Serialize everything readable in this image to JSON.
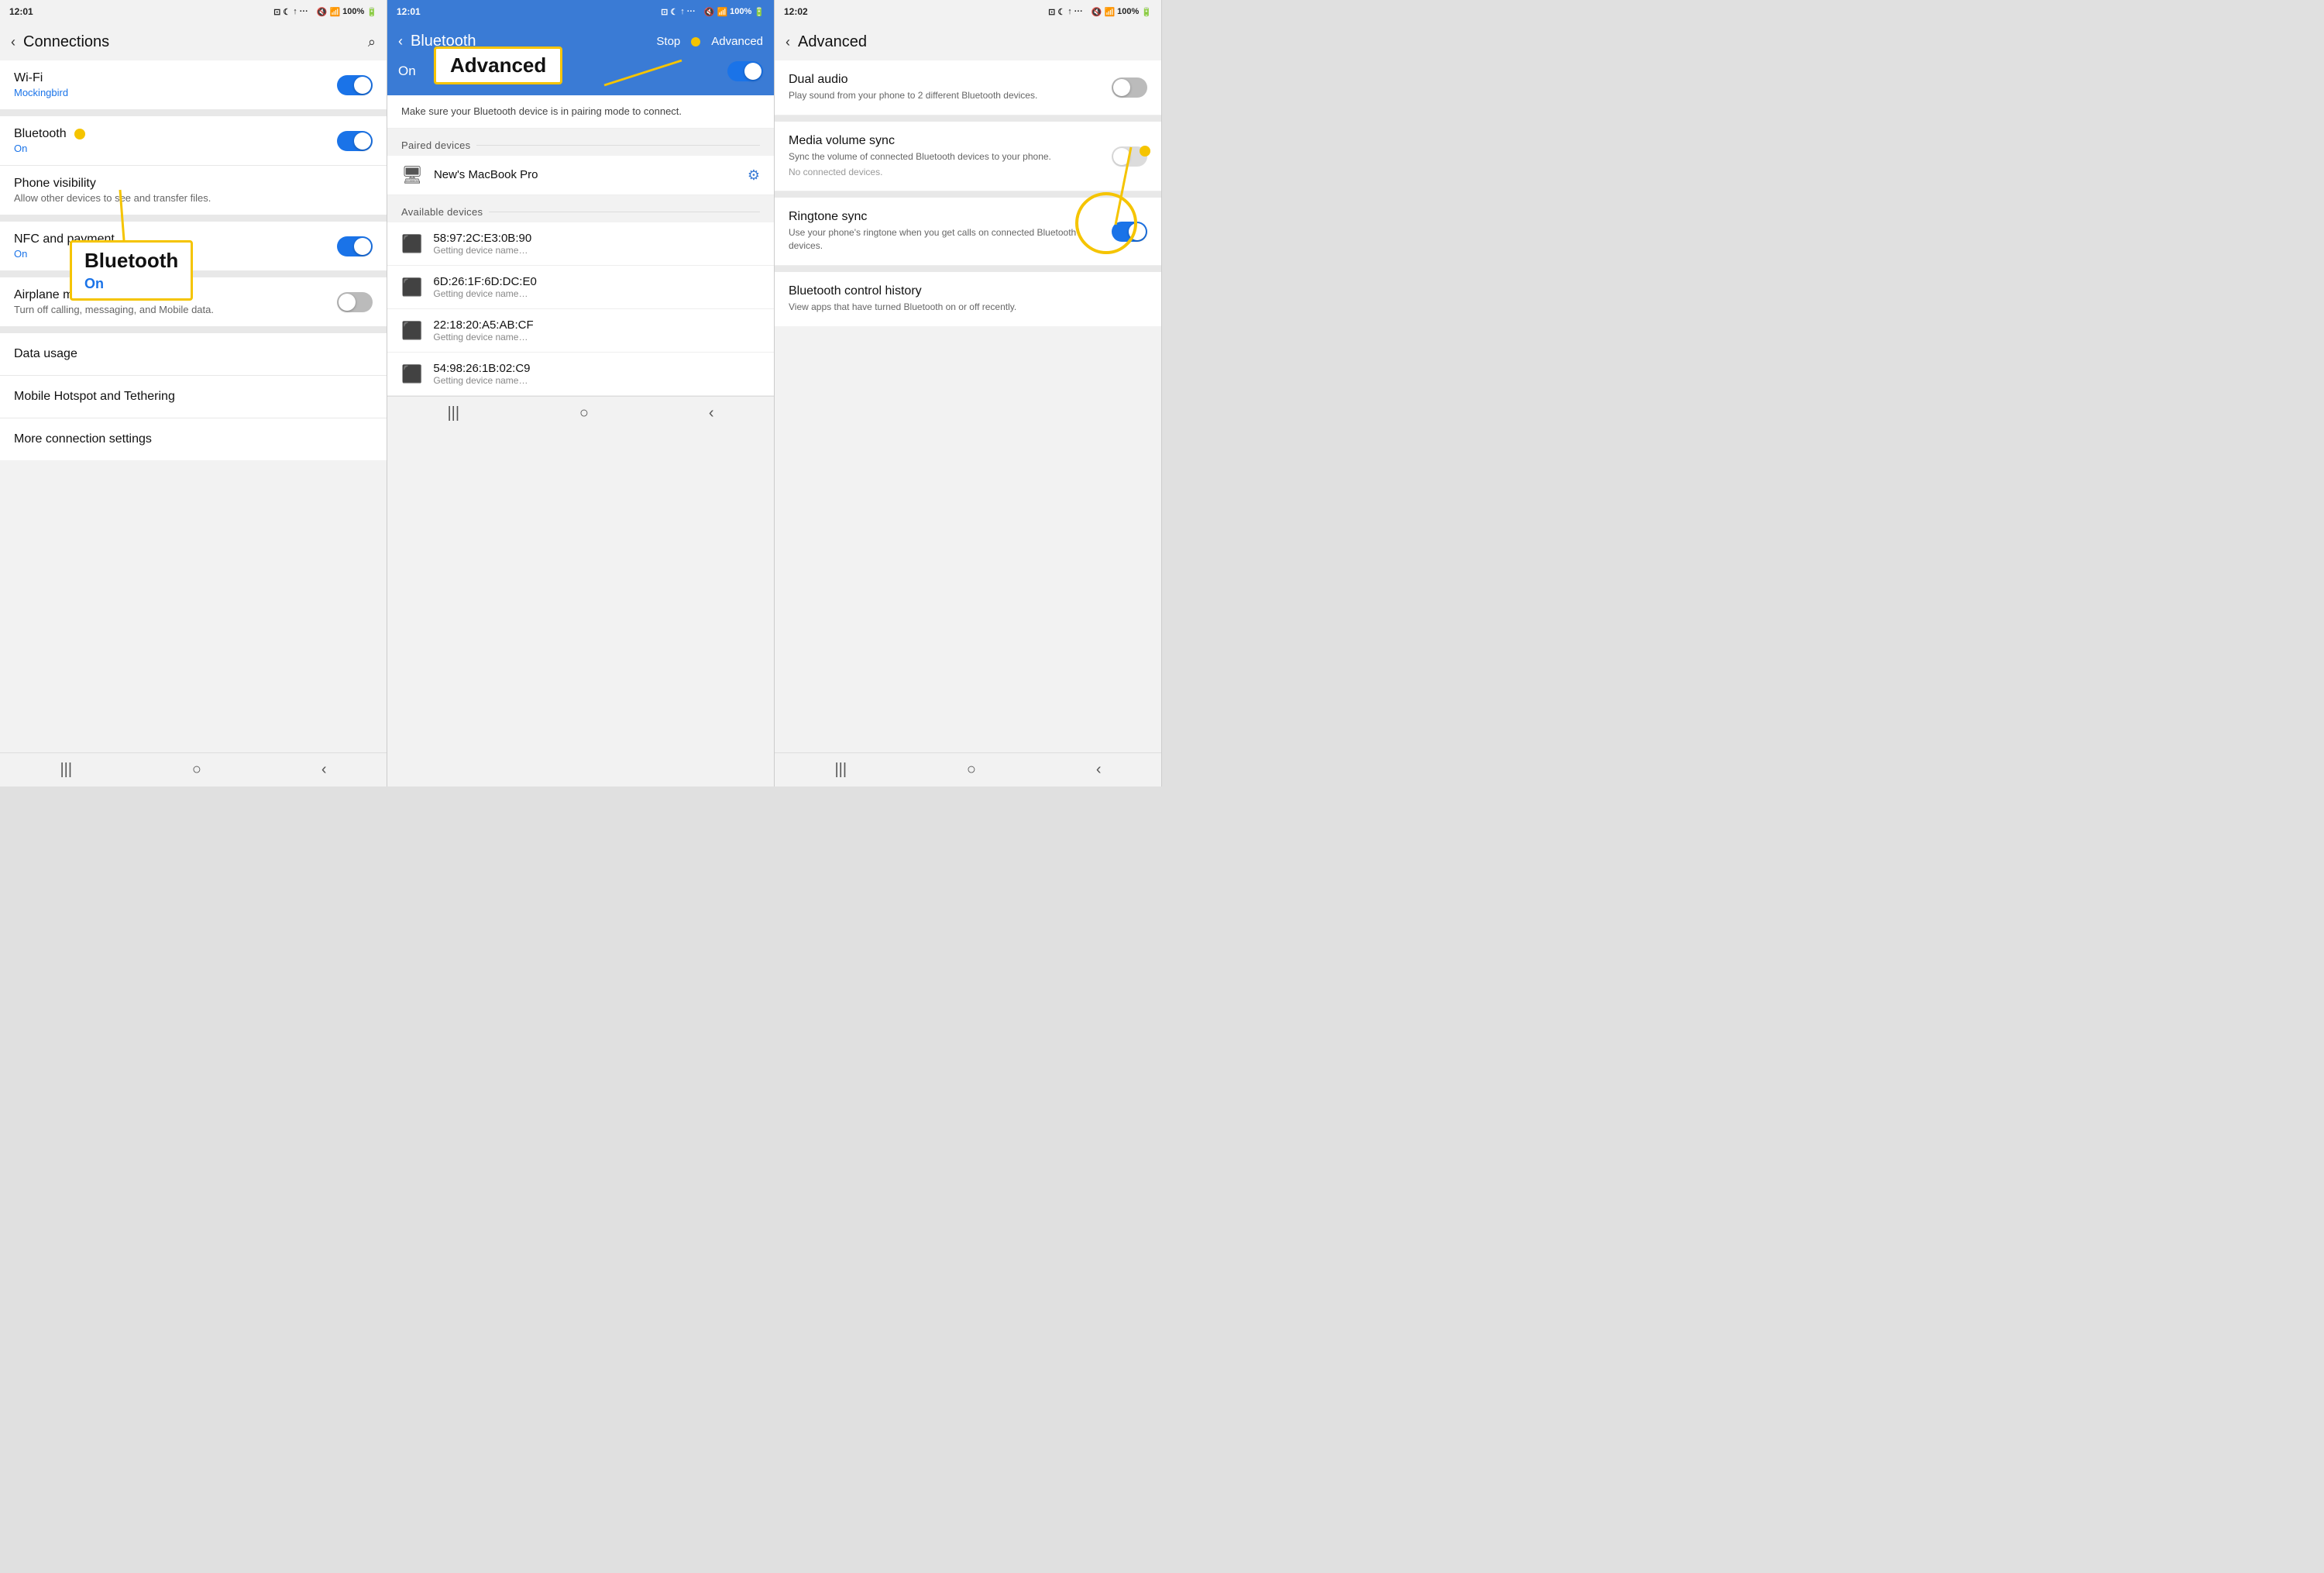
{
  "panel1": {
    "status": {
      "time": "12:01",
      "icons": "⊡ ⊙ ↑ ···  🔇 📶 100% 🔋"
    },
    "header": {
      "back": "‹",
      "title": "Connections",
      "search": "⌕"
    },
    "items": [
      {
        "name": "Wi-Fi",
        "sub": "Mockingbird",
        "subColor": "blue",
        "toggle": "on"
      },
      {
        "name": "Bluetooth",
        "sub": "On",
        "subColor": "blue",
        "toggle": "on",
        "dot": true
      },
      {
        "name": "Phone visibility",
        "sub": "Allow other devices to see and transfer files.",
        "subColor": "grey",
        "toggle": null
      },
      {
        "name": "NFC and payment",
        "sub": "On",
        "subColor": "blue",
        "toggle": "on"
      },
      {
        "name": "Airplane mode",
        "sub": "Turn off calling, messaging, and Mobile data.",
        "subColor": "grey",
        "toggle": "off"
      },
      {
        "name": "Data usage",
        "sub": "",
        "toggle": null
      },
      {
        "name": "Mobile Hotspot and Tethering",
        "sub": "",
        "toggle": null
      },
      {
        "name": "More connection settings",
        "sub": "",
        "toggle": null
      }
    ],
    "annotation": {
      "mainText": "Bluetooth",
      "subText": "On"
    },
    "nav": [
      "|||",
      "○",
      "‹"
    ]
  },
  "panel2": {
    "status": {
      "time": "12:01",
      "icons": "⊡ ⊙ ↑ ···  🔇 📶 100% 🔋"
    },
    "header": {
      "back": "‹",
      "title": "Bluetooth",
      "stop": "Stop",
      "dot": "●",
      "advanced": "Advanced"
    },
    "toggleLabel": "On",
    "description": "Make sure your Bluetooth device is in pairing mode to connect.",
    "pairedSection": "Paired devices",
    "paired": [
      {
        "icon": "💻",
        "name": "New's MacBook Pro",
        "gear": true
      }
    ],
    "availableSection": "Available devices",
    "available": [
      {
        "mac": "58:97:2C:E3:0B:90",
        "status": "Getting device name…"
      },
      {
        "mac": "6D:26:1F:6D:DC:E0",
        "status": "Getting device name…"
      },
      {
        "mac": "22:18:20:A5:AB:CF",
        "status": "Getting device name…"
      },
      {
        "mac": "54:98:26:1B:02:C9",
        "status": "Getting device name…"
      }
    ],
    "annotationLabel": "Advanced",
    "nav": [
      "|||",
      "○",
      "‹"
    ]
  },
  "panel3": {
    "status": {
      "time": "12:02",
      "icons": "⊡ ⊙ ↑ ···  🔇 📶 100% 🔋"
    },
    "header": {
      "back": "‹",
      "title": "Advanced"
    },
    "items": [
      {
        "name": "Dual audio",
        "sub": "Play sound from your phone to 2 different Bluetooth devices.",
        "toggle": "off"
      },
      {
        "name": "Media volume sync",
        "sub": "Sync the volume of connected Bluetooth devices to your phone.\nNo connected devices.",
        "toggle": "off",
        "circleHighlight": true
      },
      {
        "name": "Ringtone sync",
        "sub": "Use your phone's ringtone when you get calls on connected Bluetooth devices.",
        "toggle": "on"
      },
      {
        "name": "Bluetooth control history",
        "sub": "View apps that have turned Bluetooth on or off recently.",
        "toggle": null
      }
    ],
    "nav": [
      "|||",
      "○",
      "‹"
    ]
  }
}
